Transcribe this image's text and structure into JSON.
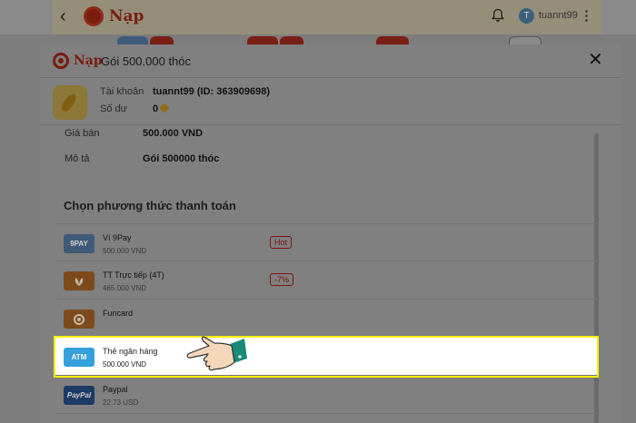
{
  "app": {
    "brand": "Nạp",
    "username": "tuannt99",
    "avatar_letter": "T"
  },
  "modal": {
    "brand": "Nạp",
    "title": "Gói 500.000 thóc",
    "close_icon": "close-icon"
  },
  "account": {
    "account_label": "Tài khoản",
    "account_value": "tuannt99 (ID: 363909698)",
    "balance_label": "Số dư",
    "balance_value": "0"
  },
  "details": {
    "price_label": "Giá bán",
    "price_value": "500.000 VND",
    "desc_label": "Mô tả",
    "desc_value": "Gói 500000 thóc"
  },
  "payment": {
    "section_title": "Chọn phương thức thanh toán",
    "methods": [
      {
        "name": "Ví 9Pay",
        "price": "500.000 VND",
        "badge": "Hot",
        "icon": "9PAY",
        "color": "#3e5a76"
      },
      {
        "name": "TT Trực tiếp (4T)",
        "price": "465.000 VND",
        "badge": "-7%",
        "icon": "",
        "color": "#7d4a1c"
      },
      {
        "name": "Funcard",
        "price": "",
        "badge": "",
        "icon": "",
        "color": "#7d4a1c"
      },
      {
        "name": "Thẻ ngân hàng",
        "price": "500.000 VND",
        "badge": "",
        "icon": "ATM",
        "color": "#34a0dc"
      },
      {
        "name": "Paypal",
        "price": "22.73 USD",
        "badge": "",
        "icon": "PayPal",
        "color": "#1d3a66"
      }
    ],
    "selected_index": 3
  },
  "colors": {
    "brand_red": "#e8361c",
    "highlight": "#ffef00"
  }
}
